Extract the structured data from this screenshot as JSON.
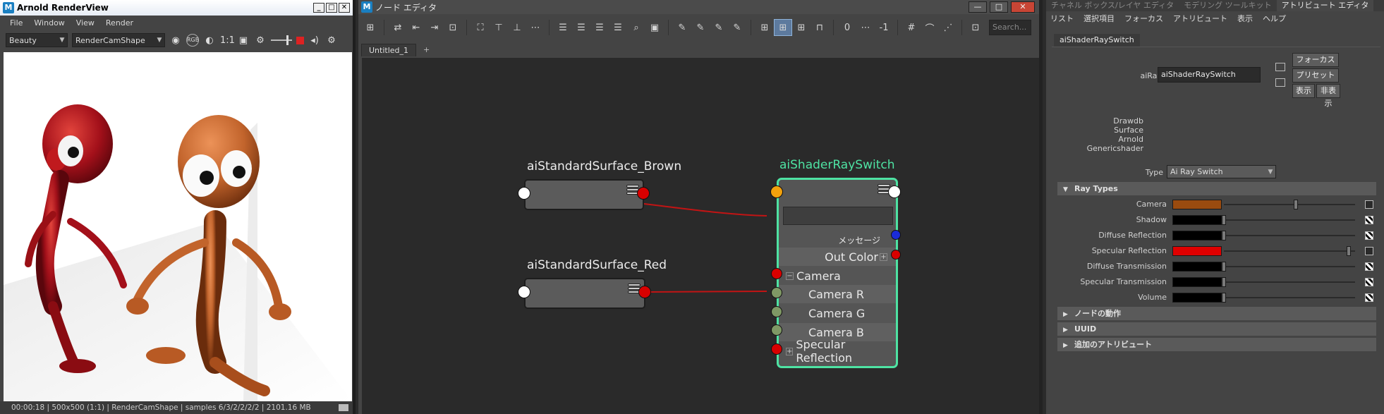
{
  "renderview": {
    "title": "Arnold RenderView",
    "app_icon": "M",
    "win_buttons": [
      "_",
      "□",
      "✕"
    ],
    "menus": [
      "File",
      "Window",
      "View",
      "Render"
    ],
    "toolbar": {
      "aov": "Beauty",
      "camera": "RenderCamShape",
      "rgb_label": "RGB",
      "ratio": "1:1"
    },
    "status": "00:00:18 | 500x500 (1:1) | RenderCamShape  | samples 6/3/2/2/2/2 | 2101.16 MB"
  },
  "node_editor": {
    "title": "ノード エディタ",
    "app_icon": "M",
    "win_buttons": [
      "—",
      "□",
      "✕"
    ],
    "toolbar": {
      "field_zero": "0",
      "field_minus_one": "-1",
      "search_placeholder": "Search..."
    },
    "tabs": [
      "Untitled_1",
      "+"
    ],
    "nodes": {
      "brown": {
        "title": "aiStandardSurface_Brown"
      },
      "red": {
        "title": "aiStandardSurface_Red"
      },
      "switch": {
        "title": "aiShaderRaySwitch",
        "message_label": "メッセージ",
        "out_color_label": "Out Color",
        "attrs": [
          "Camera",
          "Camera R",
          "Camera G",
          "Camera B",
          "Specular Reflection"
        ]
      }
    },
    "colors": {
      "node_highlight": "#4ee3a3",
      "connection": "#c21414"
    }
  },
  "attribute_editor": {
    "top_tabs": [
      "チャネル ボックス/レイヤ エディタ",
      "モデリング ツールキット",
      "アトリビュート エディタ"
    ],
    "menus": [
      "リスト",
      "選択項目",
      "フォーカス",
      "アトリビュート",
      "表示",
      "ヘルプ"
    ],
    "node_tab": "aiShaderRaySwitch",
    "name_label": "aiRaySwitch:",
    "name_value": "aiShaderRaySwitch",
    "buttons": {
      "focus": "フォーカス",
      "preset": "プリセット",
      "show": "表示",
      "hide": "非表示"
    },
    "classification": [
      "Drawdb",
      "Surface",
      "Arnold",
      "Genericshader"
    ],
    "type_label": "Type",
    "type_value": "Ai Ray Switch",
    "sections": {
      "ray_types": "Ray Types",
      "node_behavior": "ノードの動作",
      "uuid": "UUID",
      "extra": "追加のアトリビュート"
    },
    "ray_rows": [
      {
        "label": "Camera",
        "color": "#9a4b0f",
        "slider": 0.55,
        "linked": true
      },
      {
        "label": "Shadow",
        "color": "#000000",
        "slider": 0.0,
        "linked": false
      },
      {
        "label": "Diffuse Reflection",
        "color": "#000000",
        "slider": 0.0,
        "linked": false
      },
      {
        "label": "Specular Reflection",
        "color": "#e00000",
        "slider": 0.95,
        "linked": true
      },
      {
        "label": "Diffuse Transmission",
        "color": "#000000",
        "slider": 0.0,
        "linked": false
      },
      {
        "label": "Specular Transmission",
        "color": "#000000",
        "slider": 0.0,
        "linked": false
      },
      {
        "label": "Volume",
        "color": "#000000",
        "slider": 0.0,
        "linked": false
      }
    ]
  }
}
